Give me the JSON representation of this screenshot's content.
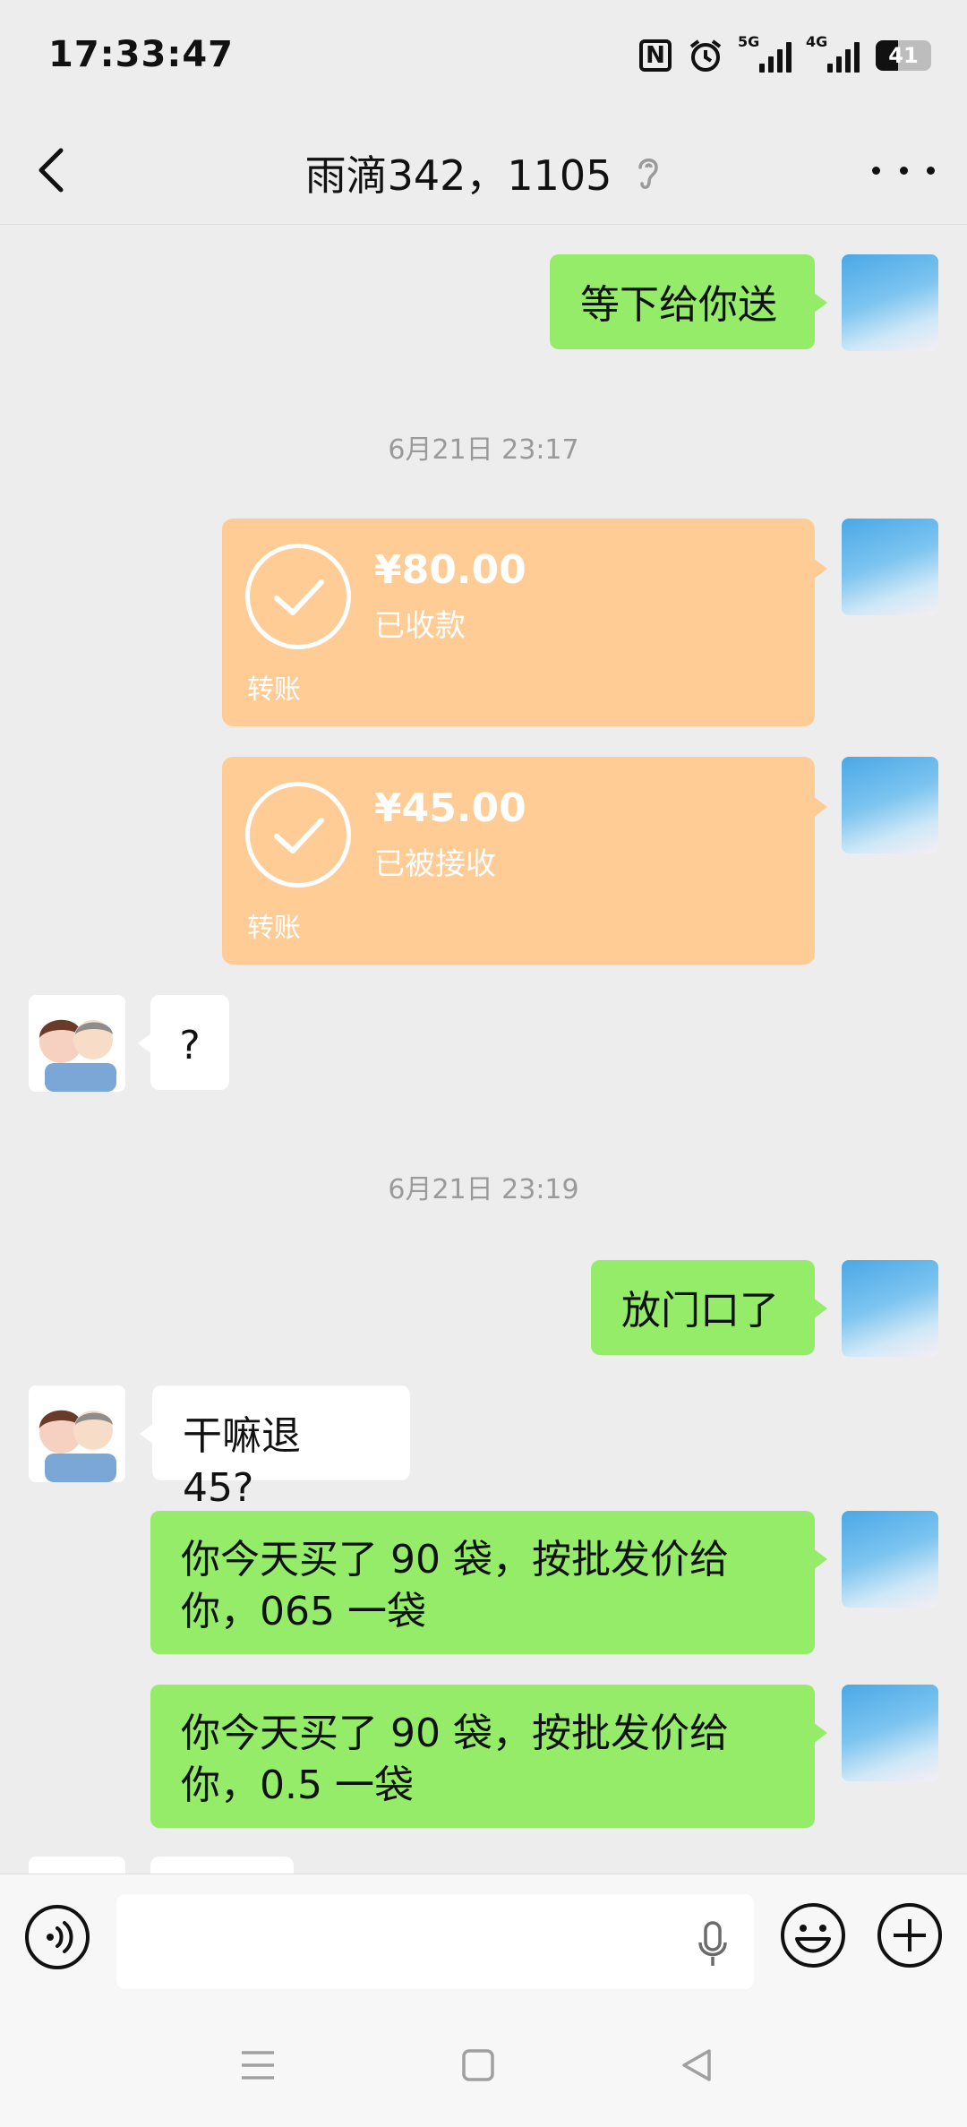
{
  "status_bar": {
    "time": "17:33:47",
    "network_5g": "5G",
    "network_4g": "4G",
    "battery_level": "41",
    "icons": [
      "nfc-icon",
      "alarm-icon",
      "signal-5g-icon",
      "signal-4g-icon",
      "battery-icon"
    ]
  },
  "header": {
    "title": "雨滴342，1105",
    "icons": [
      "back-icon",
      "ear-icon",
      "more-icon"
    ]
  },
  "messages": [
    {
      "side": "out",
      "type": "text",
      "text": "等下给你送"
    },
    {
      "type": "time",
      "text": "6月21日 23:17"
    },
    {
      "side": "out",
      "type": "transfer",
      "amount": "¥80.00",
      "status": "已收款",
      "label": "转账"
    },
    {
      "side": "out",
      "type": "transfer",
      "amount": "¥45.00",
      "status": "已被接收",
      "label": "转账"
    },
    {
      "side": "in",
      "type": "text",
      "text": "?"
    },
    {
      "type": "time",
      "text": "6月21日 23:19"
    },
    {
      "side": "out",
      "type": "text",
      "text": "放门口了"
    },
    {
      "side": "in",
      "type": "text",
      "text": "干嘛退 45?"
    },
    {
      "side": "out",
      "type": "text",
      "text": "你今天买了 90 袋，按批发价给你，065 一袋"
    },
    {
      "side": "out",
      "type": "text",
      "text": "你今天买了 90 袋，按批发价给你，0.5 一袋"
    }
  ],
  "input_bar": {
    "icons": [
      "voice-icon",
      "mic-icon",
      "emoji-icon",
      "plus-icon"
    ],
    "text_value": ""
  },
  "colors": {
    "background": "#EDEDED",
    "outgoing_bubble": "#95EC69",
    "incoming_bubble": "#FFFFFF",
    "transfer_card": "#FFCC96",
    "timestamp_text": "#9A9A9A"
  }
}
